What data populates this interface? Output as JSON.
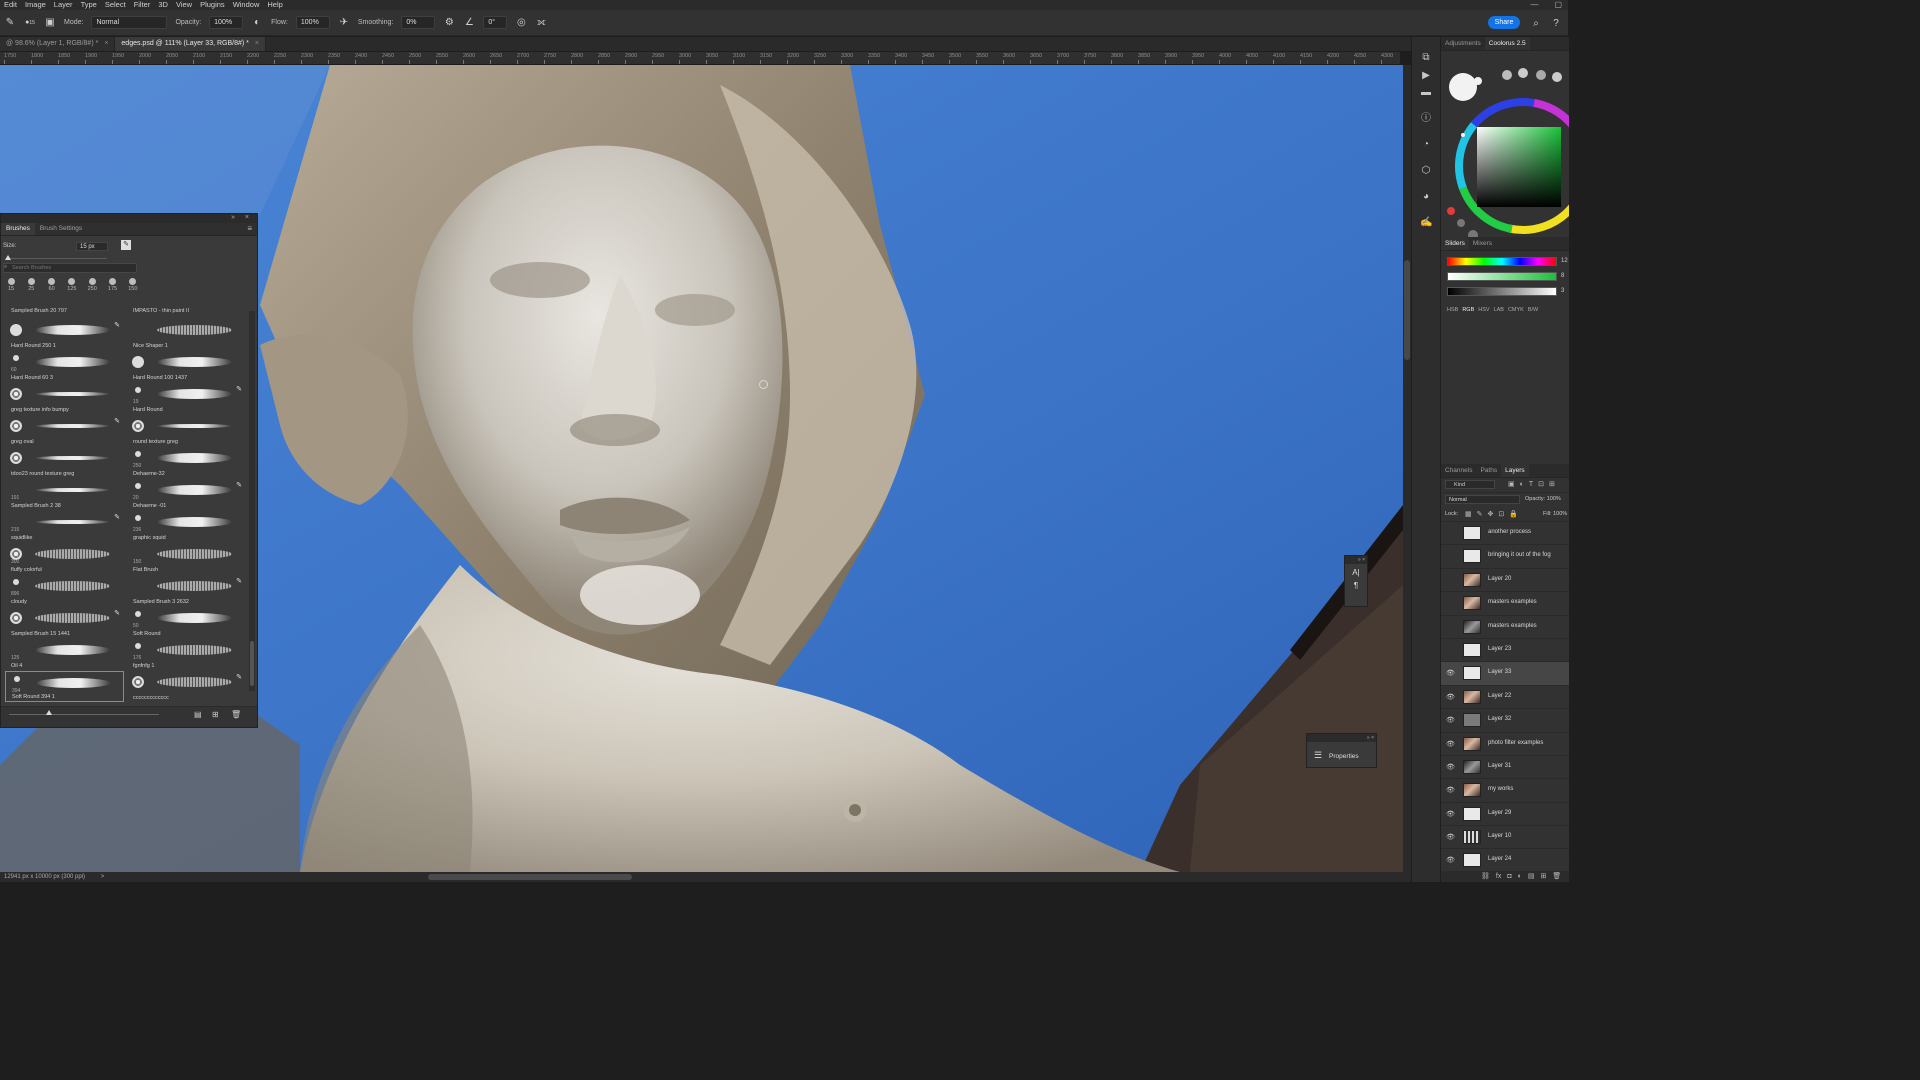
{
  "menu": [
    "Edit",
    "Image",
    "Layer",
    "Type",
    "Select",
    "Filter",
    "3D",
    "View",
    "Plugins",
    "Window",
    "Help"
  ],
  "window_controls": [
    "—",
    "▢"
  ],
  "options": {
    "mode_label": "Mode:",
    "mode_value": "Normal",
    "opacity_label": "Opacity:",
    "opacity_value": "100%",
    "flow_label": "Flow:",
    "flow_value": "100%",
    "smoothing_label": "Smoothing:",
    "smoothing_value": "0%",
    "angle_value": "0°",
    "brush_size_value": "15",
    "share_label": "Share"
  },
  "tabs": [
    {
      "label": "@ 98.6% (Layer 1, RGB/8#) *",
      "close": "×",
      "active": false
    },
    {
      "label": "edges.psd @ 111% (Layer 33, RGB/8#) *",
      "close": "×",
      "active": true
    }
  ],
  "ruler": [
    "1750",
    "1800",
    "1850",
    "1900",
    "1950",
    "2000",
    "2050",
    "2100",
    "2150",
    "2200",
    "2250",
    "2300",
    "2350",
    "2400",
    "2450",
    "2500",
    "2550",
    "2600",
    "2650",
    "2700",
    "2750",
    "2800",
    "2850",
    "2900",
    "2950",
    "3000",
    "3050",
    "3100",
    "3150",
    "3200",
    "3250",
    "3300",
    "3350",
    "3400",
    "3450",
    "3500",
    "3550",
    "3600",
    "3650",
    "3700",
    "3750",
    "3800",
    "3850",
    "3900",
    "3950",
    "4000",
    "4050",
    "4100",
    "4150",
    "4200",
    "4250",
    "4300"
  ],
  "status": {
    "doc_size": "12941 px x 10000 px (300 ppi)",
    "arrow": ">"
  },
  "brushes_panel": {
    "tabs": [
      "Brushes",
      "Brush Settings"
    ],
    "size_label": "Size:",
    "size_value": "15 px",
    "search_placeholder": "Search Brushes",
    "presets": [
      "15",
      "25",
      "60",
      "125",
      "250",
      "175",
      "150"
    ],
    "header_left": "Sampled Brush 20 797",
    "header_right": "IMPASTO - thin paint II",
    "rows": [
      [
        {
          "name": "Hard Round 250 1",
          "size": "",
          "tip": "big",
          "stroke": "normal"
        },
        {
          "name": "Nice Shaper 1",
          "size": "",
          "tip": "none",
          "stroke": "rough"
        }
      ],
      [
        {
          "name": "Hard Round 60 3",
          "size": "60",
          "tip": "small",
          "stroke": "normal"
        },
        {
          "name": "Hard Round 100 1437",
          "size": "",
          "tip": "big",
          "stroke": "normal"
        }
      ],
      [
        {
          "name": "greg texture info bumpy",
          "size": "",
          "tip": "tex",
          "stroke": "thin"
        },
        {
          "name": "Hard Round",
          "size": "19",
          "tip": "small",
          "stroke": "normal"
        }
      ],
      [
        {
          "name": "greg oval",
          "size": "",
          "tip": "tex",
          "stroke": "thin"
        },
        {
          "name": "round texture greg",
          "size": "",
          "tip": "tex",
          "stroke": "thin"
        }
      ],
      [
        {
          "name": "tdoo23 round texture greg",
          "size": "",
          "tip": "tex",
          "stroke": "thin"
        },
        {
          "name": "Dehaeme-32",
          "size": "250",
          "tip": "small",
          "stroke": "normal"
        }
      ],
      [
        {
          "name": "Sampled Brush 2 38",
          "size": "191",
          "tip": "none",
          "stroke": "thin"
        },
        {
          "name": "Dehaeme -01",
          "size": "20",
          "tip": "small",
          "stroke": "normal"
        }
      ],
      [
        {
          "name": "squidlike",
          "size": "215",
          "tip": "none",
          "stroke": "thin"
        },
        {
          "name": "graphic squid",
          "size": "236",
          "tip": "small",
          "stroke": "normal"
        }
      ],
      [
        {
          "name": "fluffy colorful",
          "size": "300",
          "tip": "tex",
          "stroke": "rough"
        },
        {
          "name": "Flat Brush",
          "size": "150",
          "tip": "none",
          "stroke": "rough"
        }
      ],
      [
        {
          "name": "cloudy",
          "size": "896",
          "tip": "small",
          "stroke": "rough"
        },
        {
          "name": "Sampled Brush 3 2632",
          "size": "",
          "tip": "none",
          "stroke": "rough"
        }
      ],
      [
        {
          "name": "Sampled Brush 15 1441",
          "size": "",
          "tip": "tex",
          "stroke": "rough"
        },
        {
          "name": "Soft Round",
          "size": "50",
          "tip": "small",
          "stroke": "normal"
        }
      ],
      [
        {
          "name": "Oil 4",
          "size": "125",
          "tip": "none",
          "stroke": "normal"
        },
        {
          "name": "fgnfnfg 1",
          "size": "176",
          "tip": "small",
          "stroke": "rough"
        }
      ],
      [
        {
          "name": "Soft Round 394 1",
          "size": "394",
          "tip": "small",
          "stroke": "normal",
          "selected": true
        },
        {
          "name": "ccccccccccccc",
          "size": "",
          "tip": "tex",
          "stroke": "rough"
        }
      ]
    ]
  },
  "right_panel": {
    "top_tabs": [
      "Adjustments",
      "Coolorus 2.5"
    ],
    "slider_tabs": [
      "Sliders",
      "Mixers"
    ],
    "slider_values": [
      "12",
      "8",
      "3"
    ],
    "color_modes": [
      "HSB",
      "RGB",
      "HSV",
      "LAB",
      "CMYK",
      "B/W"
    ],
    "layer_tabs": [
      "Channels",
      "Paths",
      "Layers"
    ],
    "kind_label": "Kind",
    "blend_mode": "Normal",
    "opacity_label": "Opacity:",
    "opacity_value": "100%",
    "lock_label": "Lock:",
    "fill_label": "Fill:",
    "fill_value": "100%",
    "layers": [
      {
        "name": "another process",
        "visible": false,
        "thumb": "white"
      },
      {
        "name": "bringing it out of the fog",
        "visible": false,
        "thumb": "white"
      },
      {
        "name": "Layer 20",
        "visible": false,
        "thumb": "photo"
      },
      {
        "name": "masters examples",
        "visible": false,
        "thumb": "photo"
      },
      {
        "name": "masters examples",
        "visible": false,
        "thumb": "dark"
      },
      {
        "name": "Layer 23",
        "visible": false,
        "thumb": "white"
      },
      {
        "name": "Layer 33",
        "visible": true,
        "thumb": "white",
        "active": true
      },
      {
        "name": "Layer 22",
        "visible": true,
        "thumb": "photo"
      },
      {
        "name": "Layer 32",
        "visible": true,
        "thumb": "grey"
      },
      {
        "name": "photo filter examples",
        "visible": true,
        "thumb": "photo"
      },
      {
        "name": "Layer 31",
        "visible": true,
        "thumb": "dark"
      },
      {
        "name": "my works",
        "visible": true,
        "thumb": "photo"
      },
      {
        "name": "Layer 29",
        "visible": true,
        "thumb": "white"
      },
      {
        "name": "Layer 10",
        "visible": true,
        "thumb": "stripes"
      },
      {
        "name": "Layer 24",
        "visible": true,
        "thumb": "white"
      }
    ]
  },
  "floating": {
    "properties_label": "Properties",
    "char_icons": [
      "A|",
      "¶"
    ]
  },
  "colors": {
    "accent": "#1473e6",
    "selected_brush": "#e0703a",
    "sky": "#3f78c9"
  }
}
